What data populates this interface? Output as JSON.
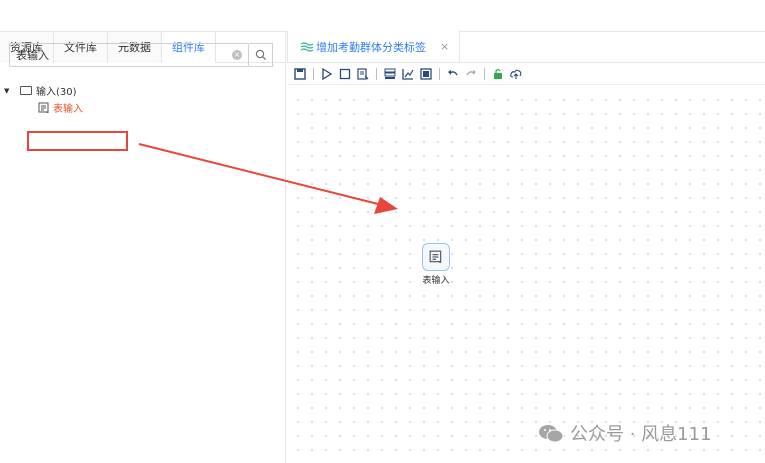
{
  "left_tabs": [
    "资源库",
    "文件库",
    "元数据",
    "组件库"
  ],
  "search": {
    "value": "表输入"
  },
  "tree": {
    "folder_label": "输入(30)",
    "child_label": "表输入"
  },
  "doc_tab": {
    "title": "增加考勤群体分类标签",
    "close": "×"
  },
  "canvas_node": {
    "label": "表输入"
  },
  "watermark": {
    "text": "公众号 · 风息111"
  },
  "colors": {
    "accent": "#2f7df6",
    "highlight": "#e8453c",
    "node_text": "#e8522a"
  }
}
